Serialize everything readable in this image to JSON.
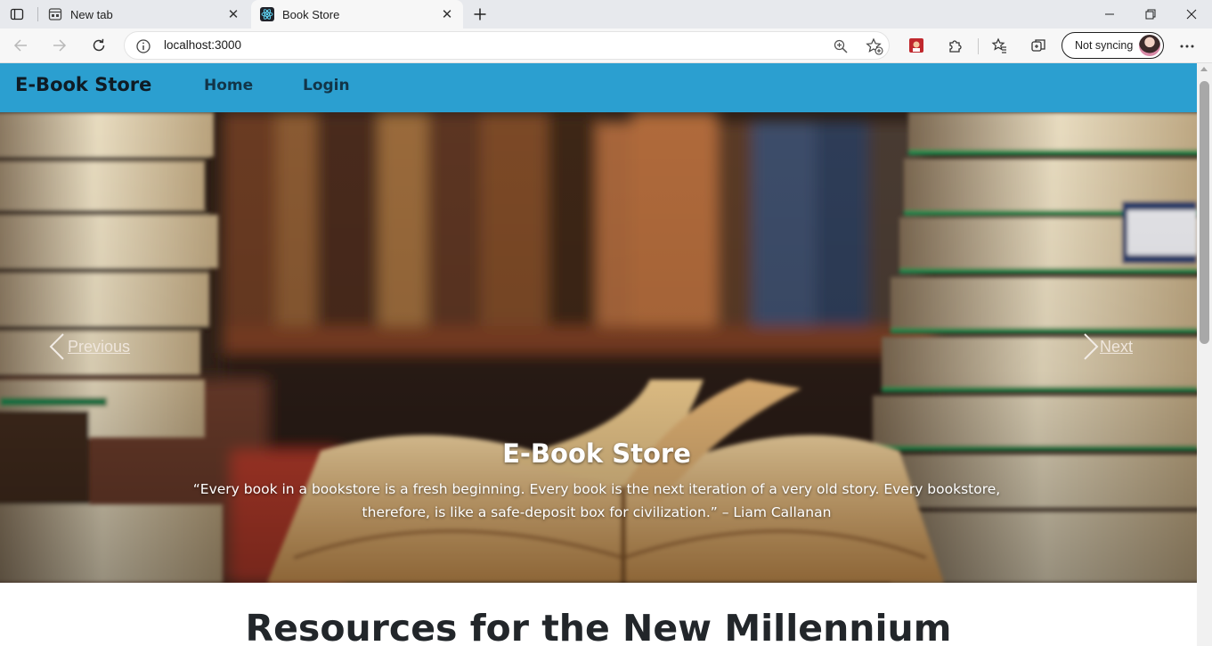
{
  "browser": {
    "tabs": [
      {
        "label": "New tab",
        "active": false,
        "icon": "new-tab-page-icon"
      },
      {
        "label": "Book Store",
        "active": true,
        "icon": "react-atom-icon"
      }
    ],
    "address": {
      "url": "localhost:3000"
    },
    "profile": {
      "label": "Not syncing"
    }
  },
  "site": {
    "brand": "E-Book Store",
    "nav": [
      {
        "label": "Home"
      },
      {
        "label": "Login"
      }
    ],
    "carousel": {
      "prev_label": "Previous",
      "next_label": "Next",
      "caption_title": "E-Book Store",
      "caption_text": "“Every book in a bookstore is a fresh beginning. Every book is the next iteration of a very old story. Every bookstore, therefore, is like a safe-deposit box for civilization.” – Liam Callanan"
    },
    "section_title": "Resources for the New Millennium"
  },
  "colors": {
    "navbar": "#2b9fd0",
    "brand_text": "#0f1b24",
    "nav_link": "#123548",
    "tab_strip": "#e7e9ed",
    "toolbar": "#f7f7f7"
  }
}
